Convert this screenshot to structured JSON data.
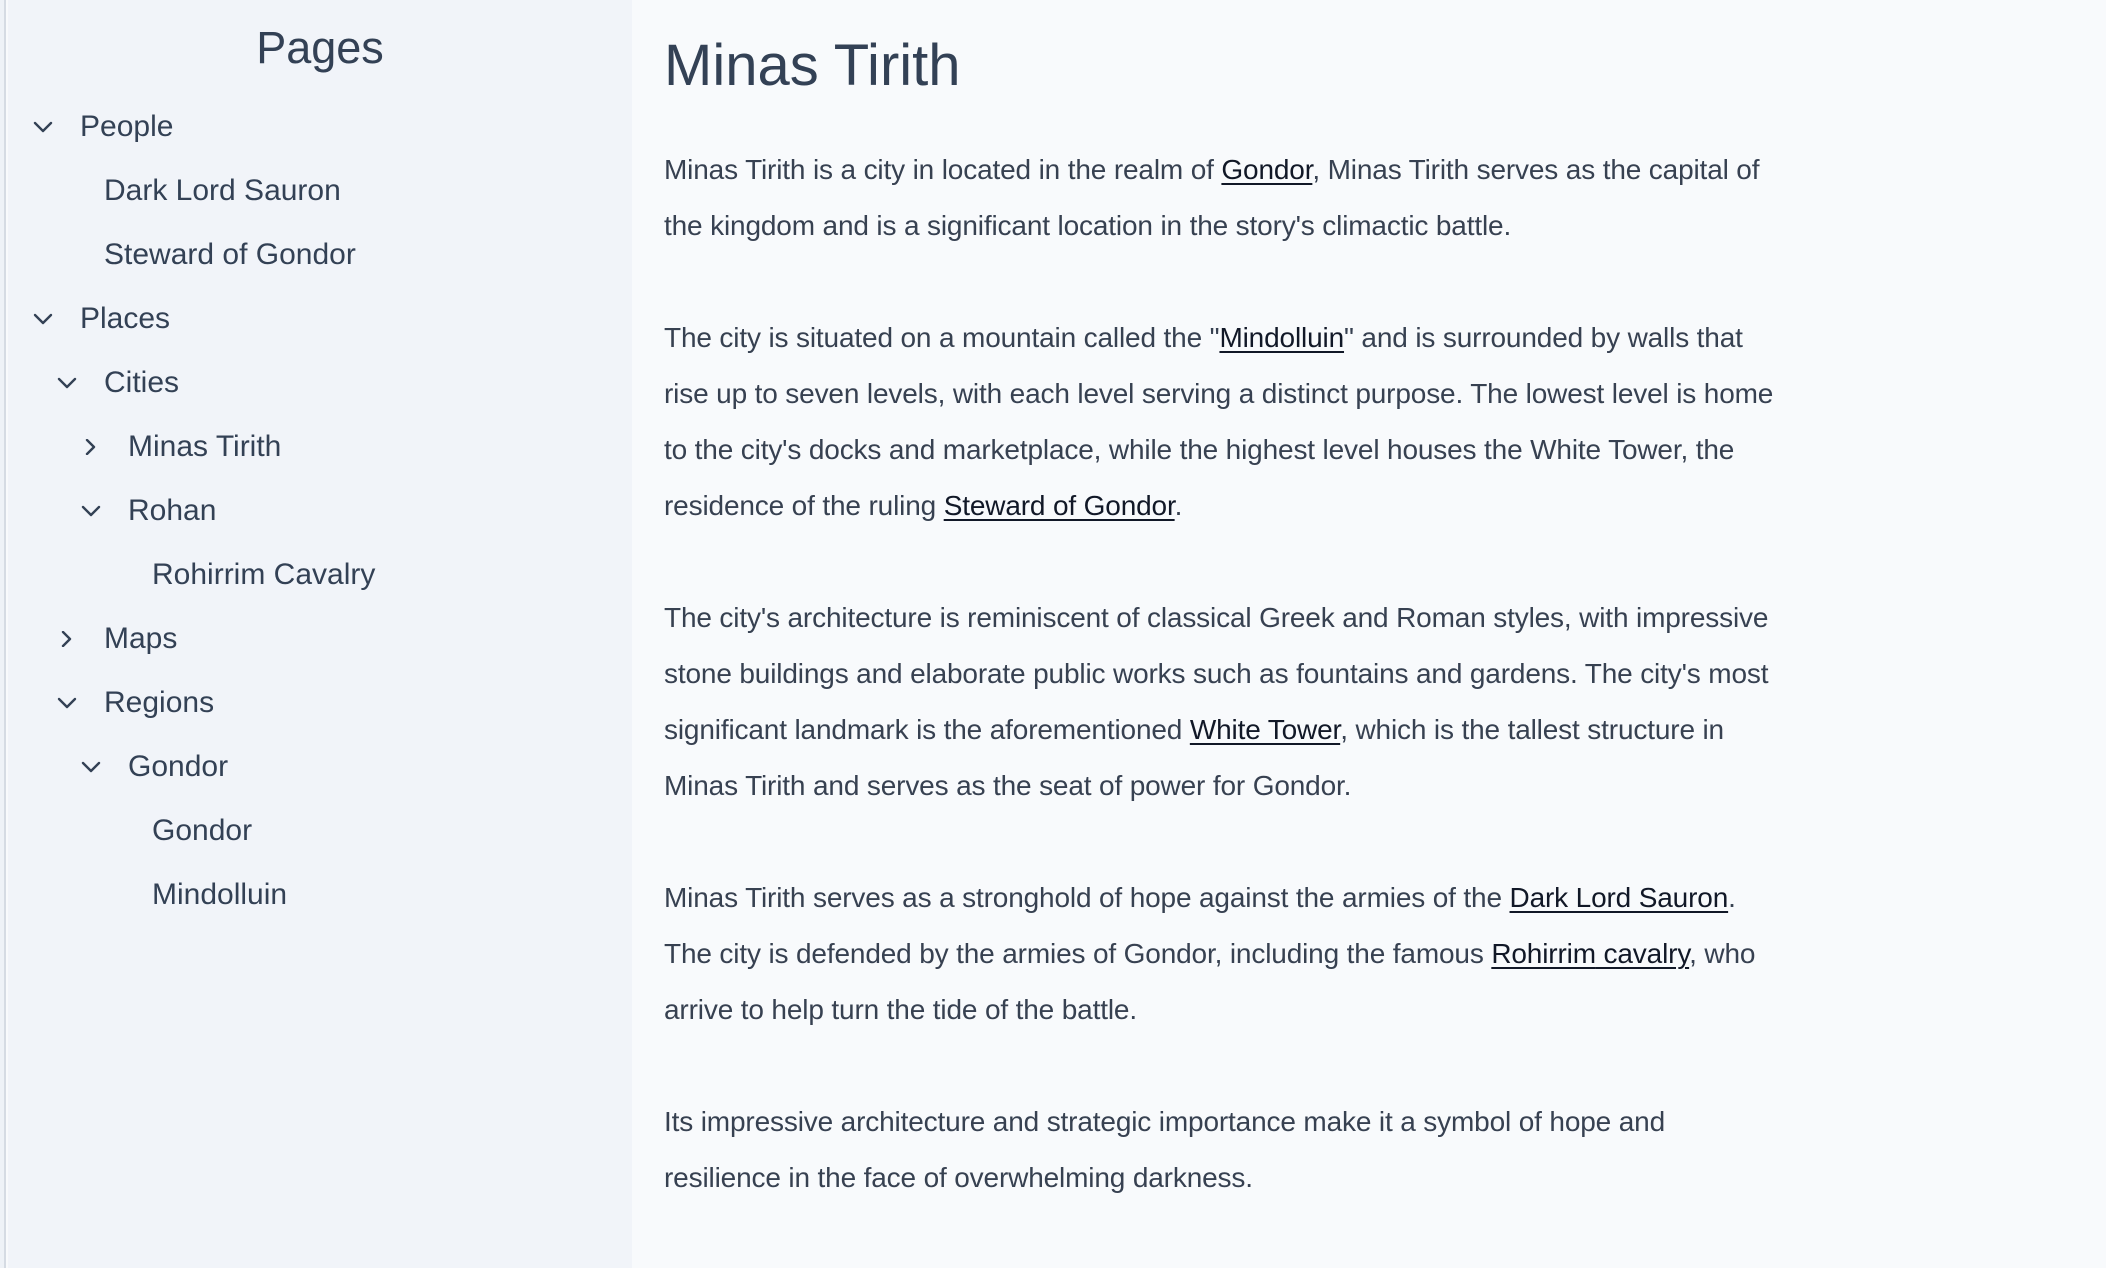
{
  "sidebar": {
    "title": "Pages",
    "items": [
      {
        "label": "People",
        "level": 0,
        "chevron": "chevron-down-icon"
      },
      {
        "label": "Dark Lord Sauron",
        "level": 1,
        "chevron": null
      },
      {
        "label": "Steward of Gondor",
        "level": 1,
        "chevron": null
      },
      {
        "label": "Places",
        "level": 0,
        "chevron": "chevron-down-icon"
      },
      {
        "label": "Cities",
        "level": 1,
        "chevron": "chevron-down-icon"
      },
      {
        "label": "Minas Tirith",
        "level": 2,
        "chevron": "chevron-right-icon"
      },
      {
        "label": "Rohan",
        "level": 2,
        "chevron": "chevron-down-icon"
      },
      {
        "label": "Rohirrim Cavalry",
        "level": 3,
        "chevron": null
      },
      {
        "label": "Maps",
        "level": 1,
        "chevron": "chevron-right-icon"
      },
      {
        "label": "Regions",
        "level": 1,
        "chevron": "chevron-down-icon"
      },
      {
        "label": "Gondor",
        "level": 2,
        "chevron": "chevron-down-icon"
      },
      {
        "label": "Gondor",
        "level": 3,
        "chevron": null
      },
      {
        "label": "Mindolluin",
        "level": 3,
        "chevron": null
      }
    ]
  },
  "main": {
    "title": "Minas Tirith",
    "paragraphs": [
      [
        [
          {
            "t": "Minas Tirith is a city in located in the realm of "
          },
          {
            "t": "Gondor",
            "link": true
          },
          {
            "t": ", Minas Tirith serves as the capital of"
          }
        ],
        [
          {
            "t": "the kingdom and is a significant location in the story's climactic battle."
          }
        ]
      ],
      [
        [
          {
            "t": "The city is situated on a mountain called the \""
          },
          {
            "t": "Mindolluin",
            "link": true
          },
          {
            "t": "\" and is surrounded by walls that"
          }
        ],
        [
          {
            "t": "rise up to seven levels, with each level serving a distinct purpose. The lowest level is home"
          }
        ],
        [
          {
            "t": "to the city's docks and marketplace, while the highest level houses the White Tower, the"
          }
        ],
        [
          {
            "t": "residence of the ruling "
          },
          {
            "t": "Steward of Gondor",
            "link": true
          },
          {
            "t": "."
          }
        ]
      ],
      [
        [
          {
            "t": "The city's architecture is reminiscent of classical Greek and Roman styles, with impressive"
          }
        ],
        [
          {
            "t": "stone buildings and elaborate public works such as fountains and gardens. The city's most"
          }
        ],
        [
          {
            "t": "significant landmark is the aforementioned "
          },
          {
            "t": "White Tower",
            "link": true
          },
          {
            "t": ", which is the tallest structure in"
          }
        ],
        [
          {
            "t": "Minas Tirith and serves as the seat of power for Gondor."
          }
        ]
      ],
      [
        [
          {
            "t": "Minas Tirith serves as a stronghold of hope against the armies of the "
          },
          {
            "t": "Dark Lord Sauron",
            "link": true
          },
          {
            "t": "."
          }
        ],
        [
          {
            "t": "The city is defended by the armies of Gondor, including the famous "
          },
          {
            "t": "Rohirrim",
            "link": true,
            "spellcheck": true
          },
          {
            "t": " cavalry",
            "link": true
          },
          {
            "t": ", who"
          }
        ],
        [
          {
            "t": "arrive to help turn the tide of the battle."
          }
        ]
      ],
      [
        [
          {
            "t": "Its impressive architecture and strategic importance make it a symbol of hope and"
          }
        ],
        [
          {
            "t": "resilience in the face of overwhelming darkness."
          }
        ]
      ]
    ]
  },
  "colors": {
    "sidebar_bg": "#f1f4f9",
    "main_bg": "#f8fafc",
    "text": "#334155",
    "link": "#111827",
    "spellcheck": "#dc2626"
  }
}
